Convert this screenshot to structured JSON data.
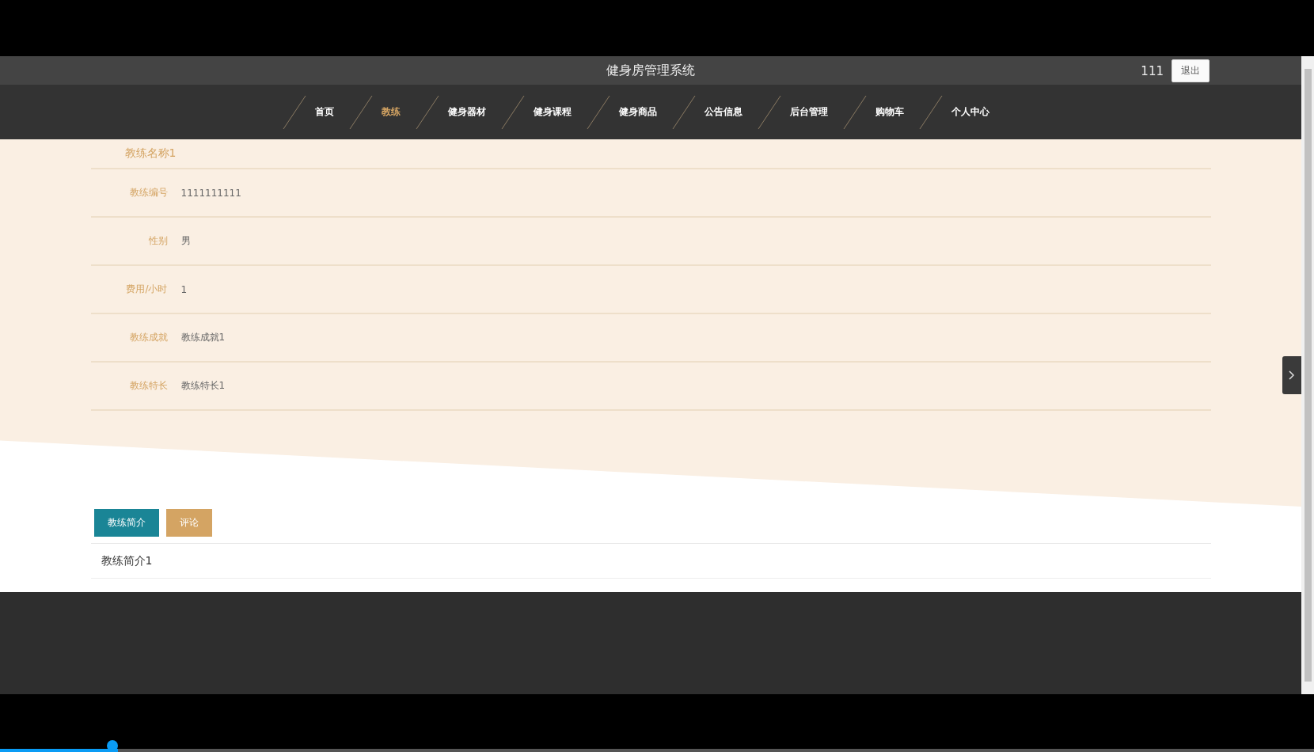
{
  "header": {
    "title": "健身房管理系统",
    "username": "111",
    "logout": "退出"
  },
  "nav": [
    {
      "label": "首页",
      "selected": false
    },
    {
      "label": "教练",
      "selected": true
    },
    {
      "label": "健身器材",
      "selected": false
    },
    {
      "label": "健身课程",
      "selected": false
    },
    {
      "label": "健身商品",
      "selected": false
    },
    {
      "label": "公告信息",
      "selected": false
    },
    {
      "label": "后台管理",
      "selected": false
    },
    {
      "label": "购物车",
      "selected": false
    },
    {
      "label": "个人中心",
      "selected": false
    }
  ],
  "detail": {
    "name": "教练名称1",
    "fields": [
      {
        "label": "教练编号",
        "value": "1111111111"
      },
      {
        "label": "性别",
        "value": "男"
      },
      {
        "label": "费用/小时",
        "value": "1"
      },
      {
        "label": "教练成就",
        "value": "教练成就1"
      },
      {
        "label": "教练特长",
        "value": "教练特长1"
      }
    ]
  },
  "tabs": [
    {
      "label": "教练简介",
      "selected": true
    },
    {
      "label": "评论",
      "selected": false
    }
  ],
  "tab_content": "教练简介1",
  "video_player": {
    "level": 0.09
  }
}
